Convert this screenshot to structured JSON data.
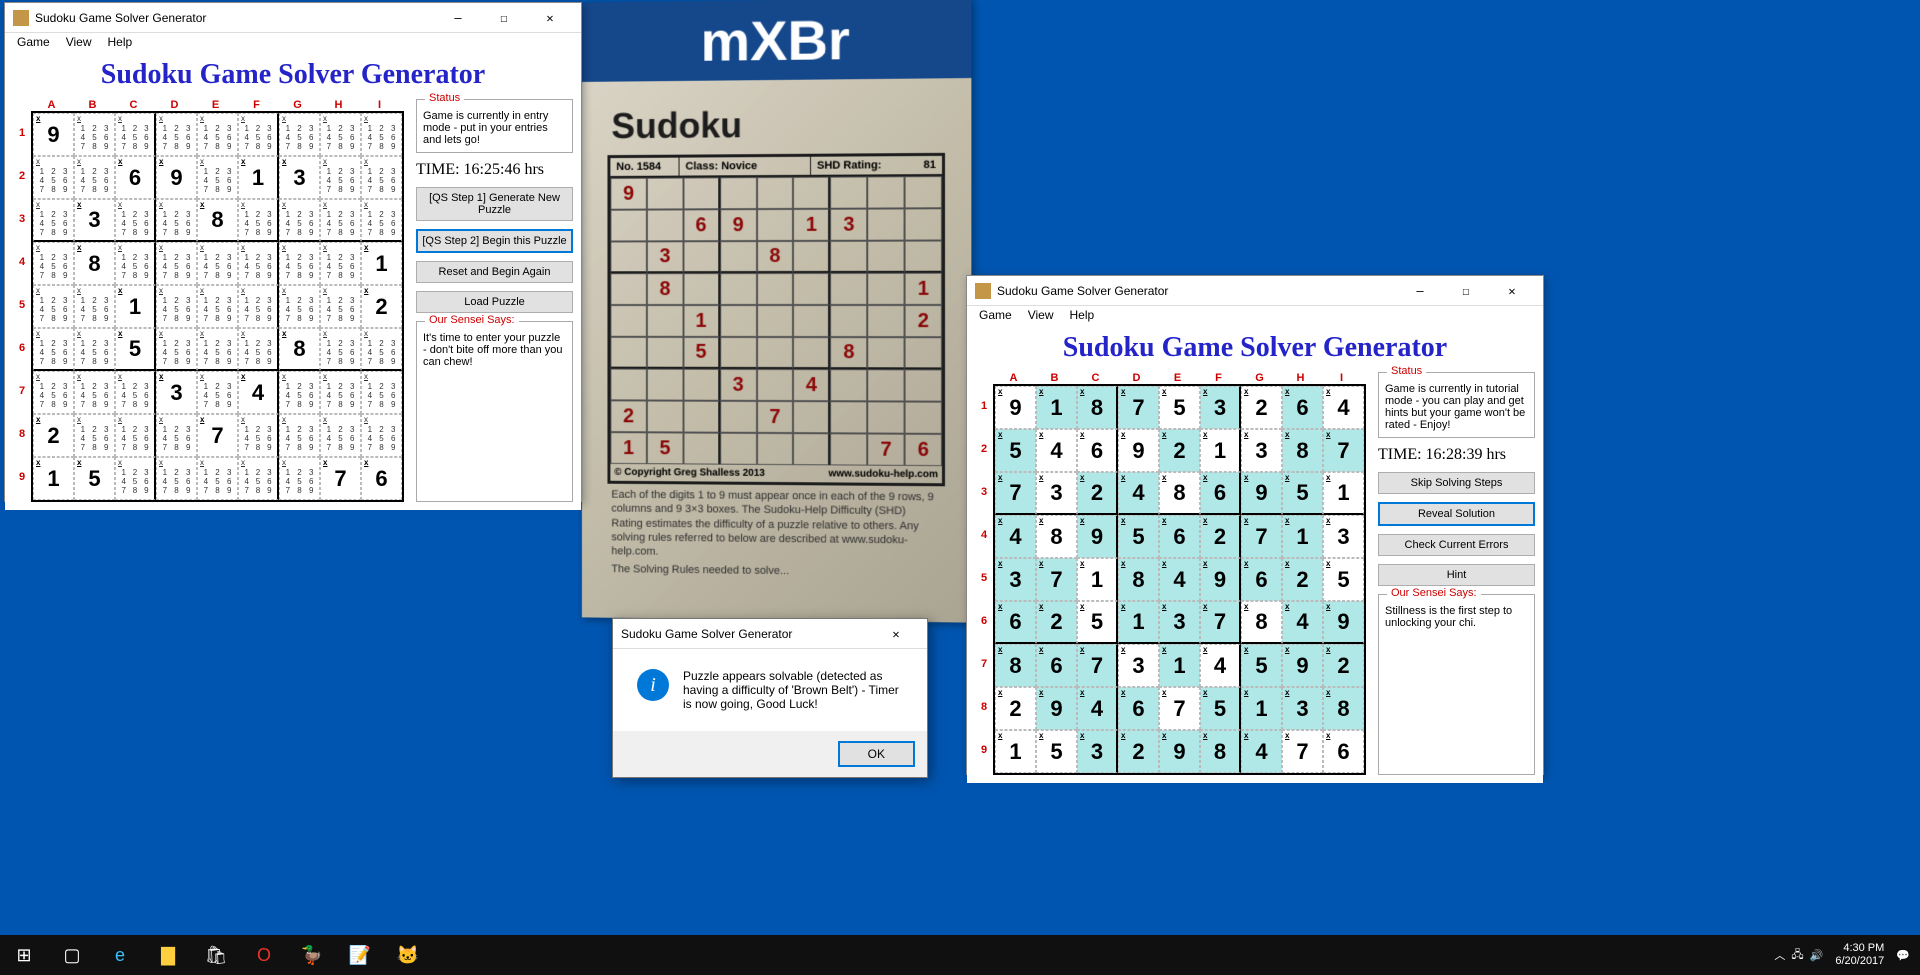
{
  "desktop": {
    "bg": "#0055b0"
  },
  "app_title": "Sudoku Game Solver Generator",
  "menu": {
    "game": "Game",
    "view": "View",
    "help": "Help"
  },
  "window1": {
    "title": "Sudoku Game Solver Generator",
    "heading": "Sudoku Game Solver Generator",
    "cols": [
      "A",
      "B",
      "C",
      "D",
      "E",
      "F",
      "G",
      "H",
      "I"
    ],
    "rows": [
      "1",
      "2",
      "3",
      "4",
      "5",
      "6",
      "7",
      "8",
      "9"
    ],
    "status_label": "Status",
    "status_text": "Game is currently in entry mode - put in your entries and lets go!",
    "time_label": "TIME:",
    "time_value": "16:25:46 hrs",
    "btn1": "[QS Step 1] Generate New Puzzle",
    "btn2": "[QS Step 2] Begin this Puzzle",
    "btn3": "Reset and Begin Again",
    "btn4": "Load Puzzle",
    "sensei_label": "Our Sensei Says:",
    "sensei_text": "It's time to enter your puzzle - don't bite off more than you can chew!",
    "givens": {
      "r1c1": "9",
      "r2c3": "6",
      "r2c4": "9",
      "r2c6": "1",
      "r2c7": "3",
      "r3c2": "3",
      "r3c5": "8",
      "r4c2": "8",
      "r4c9": "1",
      "r5c3": "1",
      "r5c9": "2",
      "r6c3": "5",
      "r6c7": "8",
      "r7c4": "3",
      "r7c6": "4",
      "r8c1": "2",
      "r8c5": "7",
      "r9c1": "1",
      "r9c2": "5",
      "r9c8": "7",
      "r9c9": "6"
    }
  },
  "window2": {
    "title": "Sudoku Game Solver Generator",
    "heading": "Sudoku Game Solver Generator",
    "cols": [
      "A",
      "B",
      "C",
      "D",
      "E",
      "F",
      "G",
      "H",
      "I"
    ],
    "rows": [
      "1",
      "2",
      "3",
      "4",
      "5",
      "6",
      "7",
      "8",
      "9"
    ],
    "status_label": "Status",
    "status_text": "Game is currently in tutorial mode - you can play and get hints but your game won't be rated - Enjoy!",
    "time_label": "TIME:",
    "time_value": "16:28:39 hrs",
    "btn1": "Skip Solving Steps",
    "btn2": "Reveal Solution",
    "btn3": "Check Current Errors",
    "btn4": "Hint",
    "sensei_label": "Our Sensei Says:",
    "sensei_text": "Stillness is the first step to unlocking your chi.",
    "cells": [
      [
        "9",
        "1",
        "8",
        "7",
        "5",
        "3",
        "2",
        "6",
        "4"
      ],
      [
        "5",
        "4",
        "6",
        "9",
        "2",
        "1",
        "3",
        "8",
        "7"
      ],
      [
        "7",
        "3",
        "2",
        "4",
        "8",
        "6",
        "9",
        "5",
        "1"
      ],
      [
        "4",
        "8",
        "9",
        "5",
        "6",
        "2",
        "7",
        "1",
        "3"
      ],
      [
        "3",
        "7",
        "1",
        "8",
        "4",
        "9",
        "6",
        "2",
        "5"
      ],
      [
        "6",
        "2",
        "5",
        "1",
        "3",
        "7",
        "8",
        "4",
        "9"
      ],
      [
        "8",
        "6",
        "7",
        "3",
        "1",
        "4",
        "5",
        "9",
        "2"
      ],
      [
        "2",
        "9",
        "4",
        "6",
        "7",
        "5",
        "1",
        "3",
        "8"
      ],
      [
        "1",
        "5",
        "3",
        "2",
        "9",
        "8",
        "4",
        "7",
        "6"
      ]
    ],
    "highlights": [
      "r1c2",
      "r1c3",
      "r1c4",
      "r1c6",
      "r1c8",
      "r2c1",
      "r2c5",
      "r2c8",
      "r2c9",
      "r3c1",
      "r3c3",
      "r3c4",
      "r3c6",
      "r3c7",
      "r3c8",
      "r4c1",
      "r4c3",
      "r4c4",
      "r4c5",
      "r4c6",
      "r4c7",
      "r4c8",
      "r5c1",
      "r5c2",
      "r5c4",
      "r5c5",
      "r5c6",
      "r5c7",
      "r5c8",
      "r6c1",
      "r6c2",
      "r6c4",
      "r6c5",
      "r6c6",
      "r6c8",
      "r6c9",
      "r7c1",
      "r7c2",
      "r7c3",
      "r7c5",
      "r7c7",
      "r7c8",
      "r7c9",
      "r8c2",
      "r8c3",
      "r8c4",
      "r8c6",
      "r8c7",
      "r8c8",
      "r8c9",
      "r9c3",
      "r9c4",
      "r9c5",
      "r9c6",
      "r9c7"
    ]
  },
  "msgbox": {
    "title": "Sudoku Game Solver Generator",
    "text": "Puzzle appears solvable (detected as having a difficulty of 'Brown Belt') - Timer is now going, Good Luck!",
    "ok": "OK"
  },
  "paper": {
    "logo": "mXBr",
    "title": "Sudoku",
    "no_label": "No.",
    "no": "1584",
    "class_label": "Class:",
    "class": "Novice",
    "shd_label": "SHD Rating:",
    "shd": "81",
    "copy": "© Copyright Greg Shalless 2013",
    "site": "www.sudoku-help.com",
    "txt1": "Each of the digits 1 to 9 must appear once in each of the 9 rows, 9 columns and 9 3×3 boxes. The Sudoku-Help Difficulty (SHD) Rating estimates the difficulty of a puzzle relative to others. Any solving rules referred to below are described at www.sudoku-help.com.",
    "txt2": "The Solving Rules needed to solve...",
    "givens": {
      "r1c1": "9",
      "r2c3": "6",
      "r2c4": "9",
      "r2c6": "1",
      "r2c7": "3",
      "r3c2": "3",
      "r3c5": "8",
      "r4c2": "8",
      "r4c9": "1",
      "r5c3": "1",
      "r5c9": "2",
      "r6c3": "5",
      "r6c7": "8",
      "r7c4": "3",
      "r7c6": "4",
      "r8c1": "2",
      "r8c5": "7",
      "r9c1": "1",
      "r9c2": "5",
      "r9c8": "7",
      "r9c9": "6"
    }
  },
  "taskbar": {
    "time": "4:30 PM",
    "date": "6/20/2017"
  }
}
